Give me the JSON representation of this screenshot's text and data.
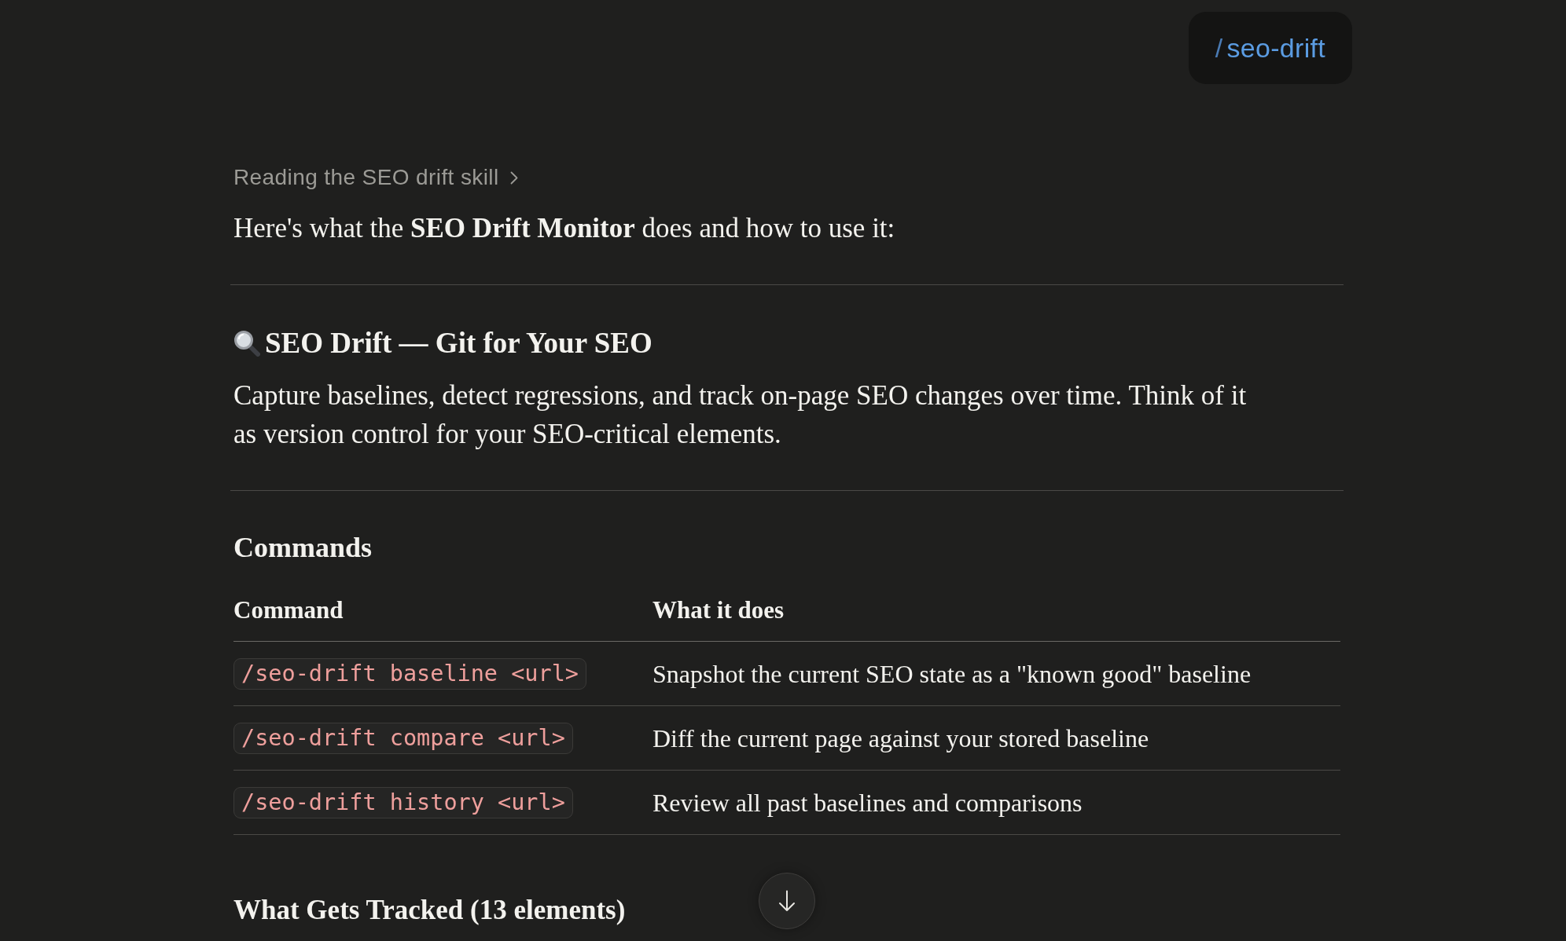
{
  "user_message": {
    "slash": "/",
    "command": "seo-drift"
  },
  "reply": {
    "thinking": {
      "label": "Reading the SEO drift skill",
      "expanded": false
    },
    "intro": "Here's what the **SEO Drift Monitor** does and how to use it:",
    "title": "SEO Drift — Git for Your SEO",
    "summary": "Capture baselines, detect regressions, and track on-page SEO changes over time. Think of it as version control for your SEO-critical elements.",
    "sections": [
      {
        "heading": "Commands",
        "table": {
          "columns": [
            "Command",
            "What it does"
          ],
          "rows": [
            {
              "command": "/seo-drift baseline <url>",
              "description": "Snapshot the current SEO state as a \"known good\" baseline"
            },
            {
              "command": "/seo-drift compare <url>",
              "description": "Diff the current page against your stored baseline"
            },
            {
              "command": "/seo-drift history <url>",
              "description": "Review all past baselines and comparisons"
            }
          ]
        }
      },
      {
        "heading": "What Gets Tracked (13 elements)"
      }
    ]
  }
}
